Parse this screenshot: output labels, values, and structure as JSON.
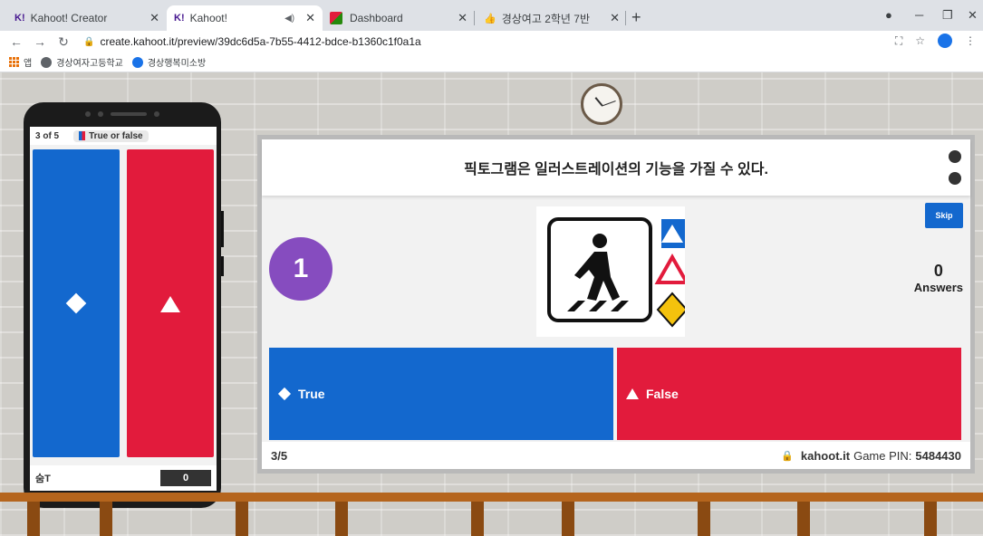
{
  "browser": {
    "tabs": [
      {
        "label": "Kahoot! Creator",
        "favicon": "K!"
      },
      {
        "label": "Kahoot!",
        "favicon": "K!"
      },
      {
        "label": "Dashboard"
      },
      {
        "label": "경상여고 2학년 7반"
      }
    ],
    "url": "create.kahoot.it/preview/39dc6d5a-7b55-4412-bdce-b1360c1f0a1a",
    "bookmarks": [
      "앱",
      "경상여자고등학교",
      "경상행복미소방"
    ]
  },
  "phone": {
    "progress": "3 of 5",
    "question_type": "True or false",
    "player_name": "숨T",
    "score": "0"
  },
  "board": {
    "question": "픽토그램은 일러스트레이션의 기능을 가질 수 있다.",
    "timer": "1",
    "skip_label": "Skip",
    "answers_count": "0",
    "answers_label": "Answers",
    "answer_true": "True",
    "answer_false": "False",
    "question_counter": "3/5",
    "site": "kahoot.it",
    "pin_label": "Game PIN:",
    "pin": "5484430"
  },
  "colors": {
    "blue": "#1368ce",
    "red": "#e21b3c",
    "purple": "#864cbf"
  }
}
